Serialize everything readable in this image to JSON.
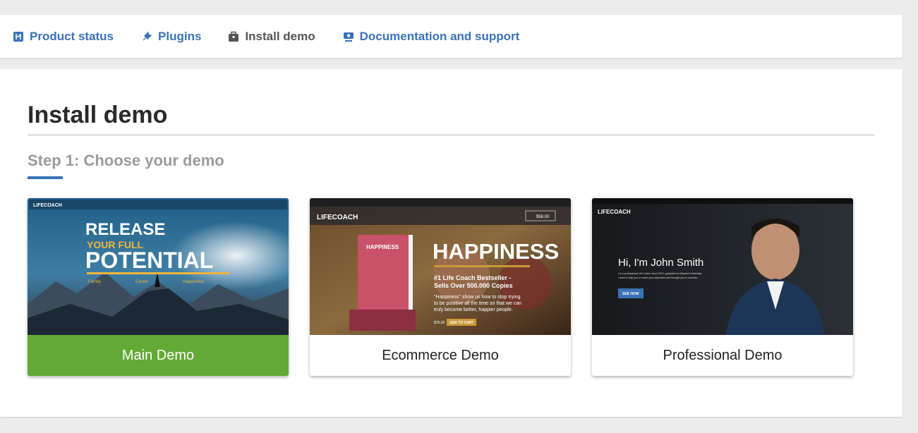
{
  "tabs": [
    {
      "label": "Product status",
      "icon": "product-status-icon"
    },
    {
      "label": "Plugins",
      "icon": "plugin-icon"
    },
    {
      "label": "Install demo",
      "icon": "briefcase-icon",
      "active": true
    },
    {
      "label": "Documentation and support",
      "icon": "monitor-icon"
    }
  ],
  "page": {
    "title": "Install demo",
    "step": "Step 1: Choose your demo"
  },
  "colors": {
    "accent": "#3a72b6",
    "selected": "#63a935"
  },
  "demos": [
    {
      "label": "Main Demo",
      "selected": true,
      "preview": {
        "logo": "LIFECOACH",
        "headline_1": "RELEASE",
        "headline_2": "YOUR FULL",
        "headline_3": "POTENTIAL",
        "col_1": "Family",
        "col_2": "Career",
        "col_3": "Happyness"
      }
    },
    {
      "label": "Ecommerce Demo",
      "selected": false,
      "preview": {
        "logo": "LIFECOACH",
        "book_title": "HAPPINESS",
        "headline": "HAPPINESS",
        "subline_1": "#1 Life Coach Bestseller -",
        "subline_2": "Sells Over 500.000 Copies",
        "body_1": "\"Happiness\" show us how to stop trying",
        "body_2": "to be positive all the time so that we can",
        "body_3": "truly become better, happier people.",
        "price": "$75.00",
        "cart_button": "ADD TO CART",
        "cart_total": "$58.00"
      }
    },
    {
      "label": "Professional Demo",
      "selected": false,
      "preview": {
        "logo": "LIFECOACH",
        "headline": "Hi, I'm John Smith",
        "body_1": "I'm a professional Life Coach since 2012, graduated at Stanford University.",
        "body_2": "I want to help you to reach your objectives and brought you to success.",
        "button": "SEE HOW"
      }
    }
  ]
}
